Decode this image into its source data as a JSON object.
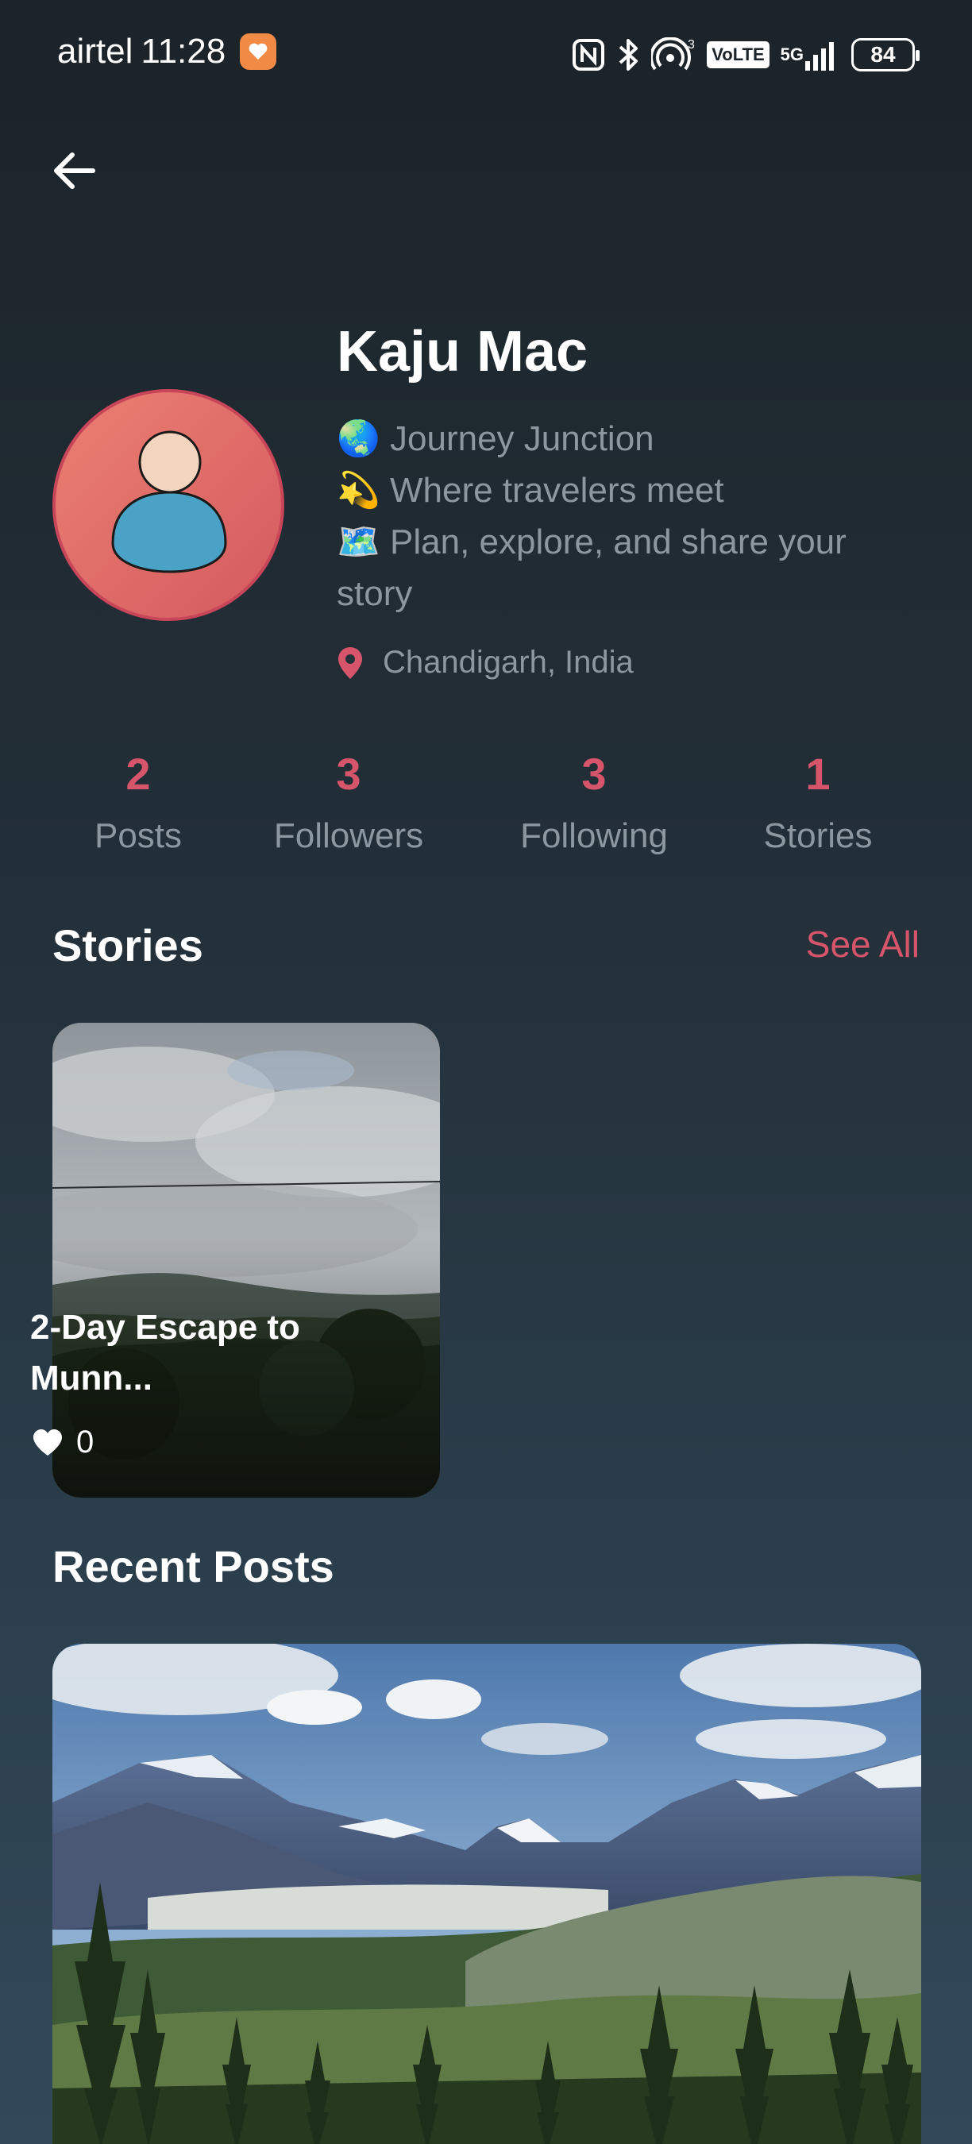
{
  "status_bar": {
    "carrier": "airtel",
    "time": "11:28",
    "network": "5G",
    "volte": "VoLTE",
    "battery": "84"
  },
  "profile": {
    "name": "Kaju Mac",
    "bio_lines": [
      "🌏 Journey Junction",
      "💫 Where travelers meet",
      "🗺️ Plan, explore, and share your story"
    ],
    "location": "Chandigarh, India"
  },
  "stats": [
    {
      "value": "2",
      "label": "Posts"
    },
    {
      "value": "3",
      "label": "Followers"
    },
    {
      "value": "3",
      "label": "Following"
    },
    {
      "value": "1",
      "label": "Stories"
    }
  ],
  "stories_section": {
    "title": "Stories",
    "see_all": "See All",
    "items": [
      {
        "title": "2-Day Escape to Munn...",
        "likes": "0"
      }
    ]
  },
  "recent_posts_section": {
    "title": "Recent Posts"
  },
  "colors": {
    "accent": "#d7556b",
    "muted_text": "#8c979f",
    "background_top": "#1b2329",
    "background_bottom": "#33495a"
  }
}
